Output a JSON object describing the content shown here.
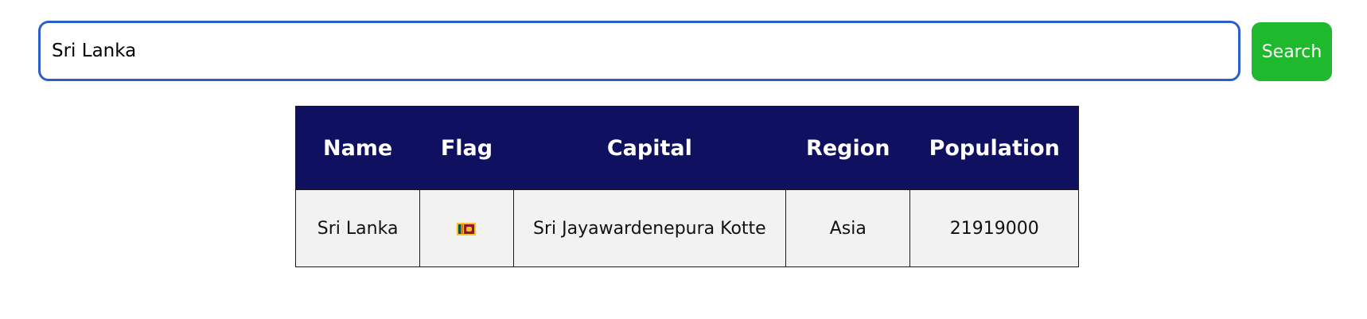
{
  "search": {
    "value": "Sri Lanka",
    "button_label": "Search"
  },
  "table": {
    "headers": [
      "Name",
      "Flag",
      "Capital",
      "Region",
      "Population"
    ],
    "rows": [
      {
        "name": "Sri Lanka",
        "flag": "sri-lanka-flag-icon",
        "capital": "Sri Jayawardenepura Kotte",
        "region": "Asia",
        "population": "21919000"
      }
    ]
  },
  "colors": {
    "input_border": "#2d5fc9",
    "button_bg": "#1eb92d",
    "header_bg": "#101060",
    "row_bg": "#f2f2f2"
  }
}
